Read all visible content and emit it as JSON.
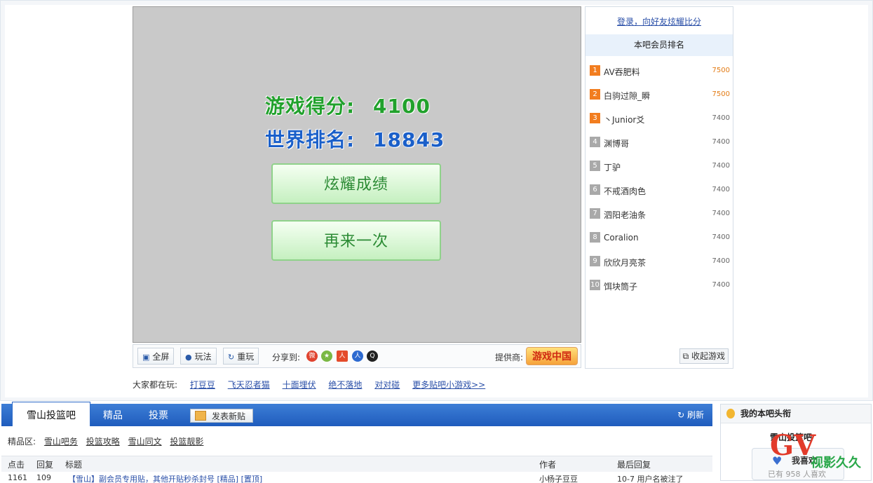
{
  "game": {
    "score_label": "游戏得分:",
    "score_value": "4100",
    "rank_label": "世界排名:",
    "rank_value": "18843",
    "show_button": "炫耀成绩",
    "retry_button": "再来一次"
  },
  "toolbar": {
    "fullscreen": "全屏",
    "howto": "玩法",
    "replay": "重玩",
    "share_label": "分享到:",
    "provider_label": "提供商:",
    "provider_logo": "游戏中国"
  },
  "everyone": {
    "label": "大家都在玩:",
    "games": [
      "打豆豆",
      "飞天忍者猫",
      "十面埋伏",
      "绝不落地",
      "对对碰",
      "更多贴吧小游戏>>"
    ]
  },
  "ranking": {
    "login_link": "登录，向好友炫耀比分",
    "header": "本吧会员排名",
    "items": [
      {
        "rank": "1",
        "name": "AV吞肥料",
        "score": "7500"
      },
      {
        "rank": "2",
        "name": "白驹过隙_瞬",
        "score": "7500"
      },
      {
        "rank": "3",
        "name": "丶Junior爻",
        "score": "7400"
      },
      {
        "rank": "4",
        "name": "渊博哥",
        "score": "7400"
      },
      {
        "rank": "5",
        "name": "丁驴",
        "score": "7400"
      },
      {
        "rank": "6",
        "name": "不戒酒肉色",
        "score": "7400"
      },
      {
        "rank": "7",
        "name": "泗阳老油条",
        "score": "7400"
      },
      {
        "rank": "8",
        "name": "Coralion",
        "score": "7400"
      },
      {
        "rank": "9",
        "name": "欣欣月亮茶",
        "score": "7400"
      },
      {
        "rank": "10",
        "name": "饵块筒子",
        "score": "7400"
      }
    ],
    "collapse": "收起游戏"
  },
  "forum": {
    "tab_active": "雪山投篮吧",
    "tab_jingpin": "精品",
    "tab_vote": "投票",
    "post_button": "发表新贴",
    "refresh": "刷新",
    "jingpin_label": "精品区:",
    "jingpin_links": [
      "雪山吧务",
      "投篮攻略",
      "雪山同文",
      "投篮靓影"
    ],
    "col_clicks": "点击",
    "col_replies": "回复",
    "col_title": "标题",
    "col_author": "作者",
    "col_last": "最后回复",
    "row1_clicks": "1161",
    "row1_replies": "109",
    "row1_title": "【雪山】副会员专用贴，其他开贴秒杀封号 [精品] [置顶]",
    "row1_author": "小杨子豆豆",
    "row1_last": "10-7 用户名被注了"
  },
  "widget": {
    "title": "我的本吧头衔",
    "bar_name": "雪山投篮吧",
    "like": "我喜欢",
    "count": "已有 958 人喜欢"
  },
  "watermark": {
    "letters": "GV",
    "text": "视影久久"
  }
}
